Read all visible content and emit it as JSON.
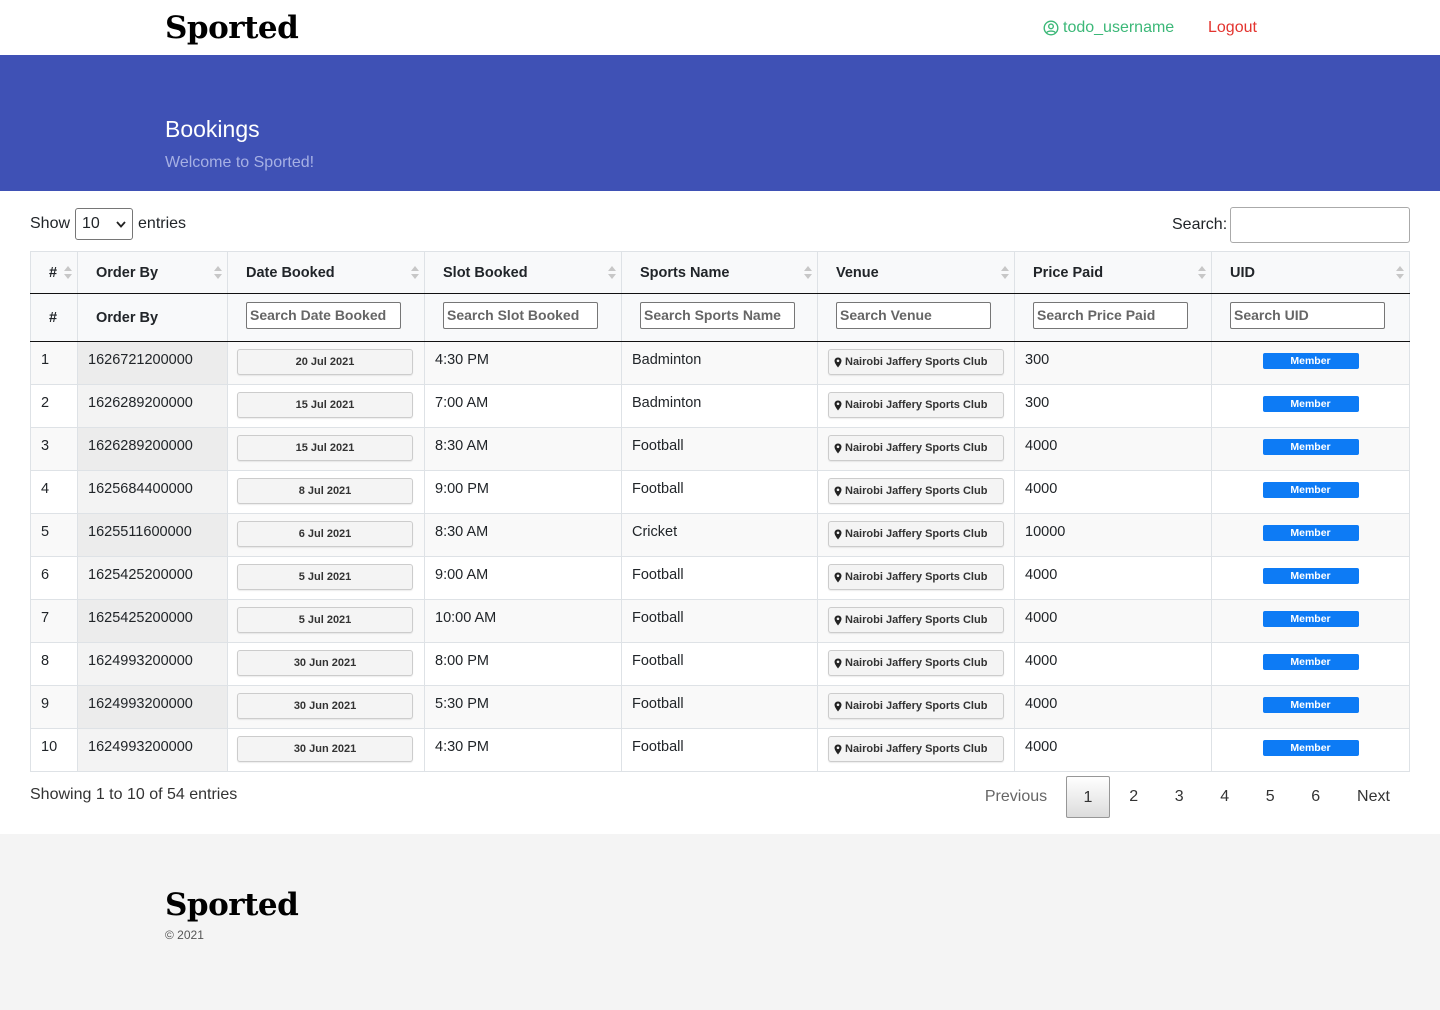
{
  "nav": {
    "brand": "Sported",
    "username": "todo_username",
    "logout_label": "Logout"
  },
  "hero": {
    "title": "Bookings",
    "subtitle": "Welcome to Sported!"
  },
  "controls": {
    "show_label": "Show",
    "entries_label": "entries",
    "page_size": "10",
    "search_label": "Search:",
    "search_value": ""
  },
  "table": {
    "headers": [
      "#",
      "Order By",
      "Date Booked",
      "Slot Booked",
      "Sports Name",
      "Venue",
      "Price Paid",
      "UID"
    ],
    "filter_row": {
      "num": "#",
      "order_by": "Order By",
      "placeholders": [
        "Search Date Booked",
        "Search Slot Booked",
        "Search Sports Name",
        "Search Venue",
        "Search Price Paid",
        "Search UID"
      ]
    },
    "rows": [
      {
        "num": "1",
        "order": "1626721200000",
        "date": "20 Jul 2021",
        "slot": "4:30 PM",
        "sport": "Badminton",
        "venue": "Nairobi Jaffery Sports Club",
        "price": "300",
        "uid": "Member"
      },
      {
        "num": "2",
        "order": "1626289200000",
        "date": "15 Jul 2021",
        "slot": "7:00 AM",
        "sport": "Badminton",
        "venue": "Nairobi Jaffery Sports Club",
        "price": "300",
        "uid": "Member"
      },
      {
        "num": "3",
        "order": "1626289200000",
        "date": "15 Jul 2021",
        "slot": "8:30 AM",
        "sport": "Football",
        "venue": "Nairobi Jaffery Sports Club",
        "price": "4000",
        "uid": "Member"
      },
      {
        "num": "4",
        "order": "1625684400000",
        "date": "8 Jul 2021",
        "slot": "9:00 PM",
        "sport": "Football",
        "venue": "Nairobi Jaffery Sports Club",
        "price": "4000",
        "uid": "Member"
      },
      {
        "num": "5",
        "order": "1625511600000",
        "date": "6 Jul 2021",
        "slot": "8:30 AM",
        "sport": "Cricket",
        "venue": "Nairobi Jaffery Sports Club",
        "price": "10000",
        "uid": "Member"
      },
      {
        "num": "6",
        "order": "1625425200000",
        "date": "5 Jul 2021",
        "slot": "9:00 AM",
        "sport": "Football",
        "venue": "Nairobi Jaffery Sports Club",
        "price": "4000",
        "uid": "Member"
      },
      {
        "num": "7",
        "order": "1625425200000",
        "date": "5 Jul 2021",
        "slot": "10:00 AM",
        "sport": "Football",
        "venue": "Nairobi Jaffery Sports Club",
        "price": "4000",
        "uid": "Member"
      },
      {
        "num": "8",
        "order": "1624993200000",
        "date": "30 Jun 2021",
        "slot": "8:00 PM",
        "sport": "Football",
        "venue": "Nairobi Jaffery Sports Club",
        "price": "4000",
        "uid": "Member"
      },
      {
        "num": "9",
        "order": "1624993200000",
        "date": "30 Jun 2021",
        "slot": "5:30 PM",
        "sport": "Football",
        "venue": "Nairobi Jaffery Sports Club",
        "price": "4000",
        "uid": "Member"
      },
      {
        "num": "10",
        "order": "1624993200000",
        "date": "30 Jun 2021",
        "slot": "4:30 PM",
        "sport": "Football",
        "venue": "Nairobi Jaffery Sports Club",
        "price": "4000",
        "uid": "Member"
      }
    ]
  },
  "footer_info": "Showing 1 to 10 of 54 entries",
  "pagination": {
    "prev_label": "Previous",
    "pages": [
      "1",
      "2",
      "3",
      "4",
      "5",
      "6"
    ],
    "current": "1",
    "next_label": "Next"
  },
  "footer": {
    "brand": "Sported",
    "copyright": "© 2021"
  },
  "colors": {
    "hero_bg": "#3f51b5",
    "username": "#3cb878",
    "logout": "#e3342f",
    "badge": "#0d7bf5"
  },
  "icons": {
    "user": "user-circle-icon",
    "venue": "map-pin-icon",
    "select": "chevron-down-icon"
  }
}
